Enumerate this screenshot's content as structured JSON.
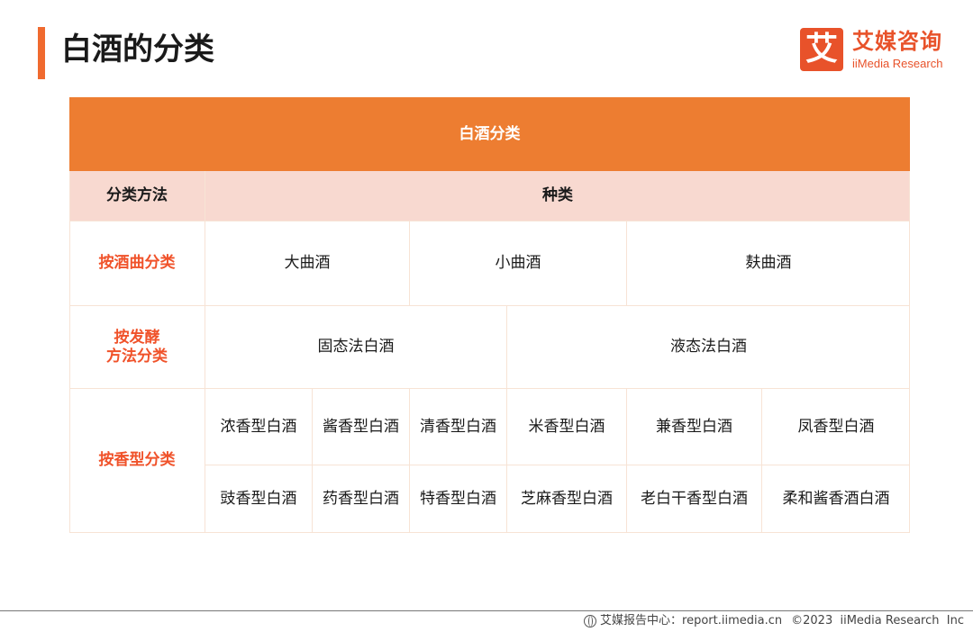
{
  "page": {
    "title": "白酒的分类"
  },
  "logo": {
    "mark": "艾",
    "name_cn": "艾媒咨询",
    "name_en": "iiMedia Research"
  },
  "table": {
    "header": "白酒分类",
    "col_method": "分类方法",
    "col_kind": "种类",
    "rows": [
      {
        "method": "按酒曲分类",
        "values": [
          "大曲酒",
          "小曲酒",
          "麸曲酒"
        ]
      },
      {
        "method_line1": "按发酵",
        "method_line2": "方法分类",
        "values": [
          "固态法白酒",
          "液态法白酒"
        ]
      },
      {
        "method": "按香型分类",
        "values_1": [
          "浓香型白酒",
          "酱香型白酒",
          "清香型白酒",
          "米香型白酒",
          "兼香型白酒",
          "凤香型白酒"
        ],
        "values_2": [
          "豉香型白酒",
          "药香型白酒",
          "特香型白酒",
          "芝麻香型白酒",
          "老白干香型白酒",
          "柔和酱香酒白酒"
        ]
      }
    ]
  },
  "footer": {
    "source_label": "艾媒报告中心：",
    "url": "report.iimedia.cn",
    "copyright": "©2023  iiMedia Research  Inc"
  }
}
